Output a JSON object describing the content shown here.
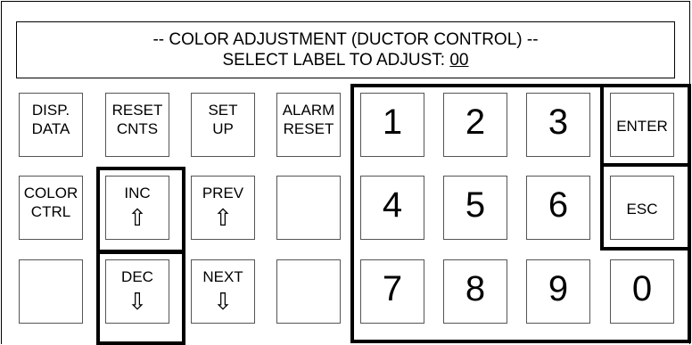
{
  "header": {
    "line1": "-- COLOR ADJUSTMENT (DUCTOR CONTROL) --",
    "line2_prefix": "SELECT LABEL TO ADJUST: ",
    "label_value": "00"
  },
  "function_buttons": {
    "disp_data": [
      "DISP.",
      "DATA"
    ],
    "reset_cnts": [
      "RESET",
      "CNTS"
    ],
    "set_up": [
      "SET",
      "UP"
    ],
    "alarm_reset": [
      "ALARM",
      "RESET"
    ],
    "color_ctrl": [
      "COLOR",
      "CTRL"
    ],
    "inc": "INC",
    "prev": "PREV",
    "dec": "DEC",
    "next": "NEXT",
    "up_arrow": "⇧",
    "down_arrow": "⇩"
  },
  "keypad": {
    "k1": "1",
    "k2": "2",
    "k3": "3",
    "k4": "4",
    "k5": "5",
    "k6": "6",
    "k7": "7",
    "k8": "8",
    "k9": "9",
    "k0": "0",
    "enter": "ENTER",
    "esc": "ESC"
  }
}
